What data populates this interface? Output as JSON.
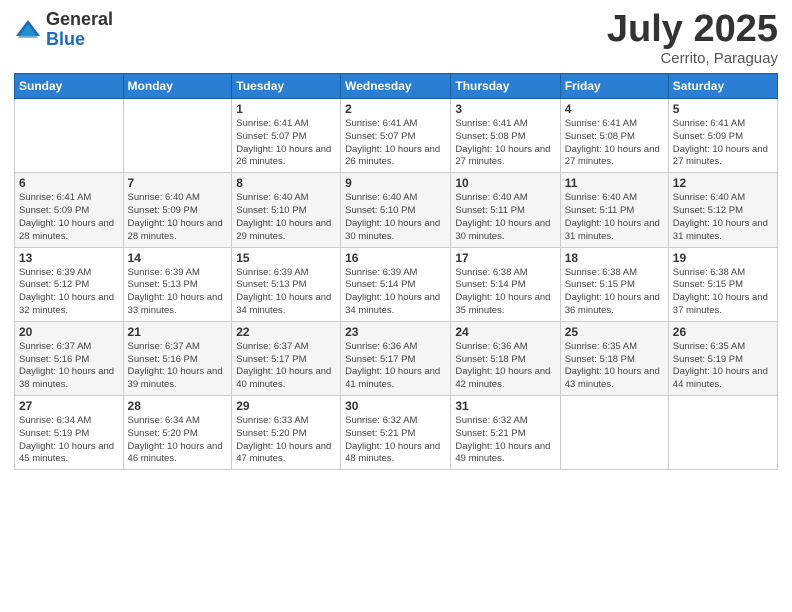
{
  "logo": {
    "general": "General",
    "blue": "Blue"
  },
  "title": {
    "month_year": "July 2025",
    "location": "Cerrito, Paraguay"
  },
  "weekdays": [
    "Sunday",
    "Monday",
    "Tuesday",
    "Wednesday",
    "Thursday",
    "Friday",
    "Saturday"
  ],
  "weeks": [
    [
      {
        "day": "",
        "info": ""
      },
      {
        "day": "",
        "info": ""
      },
      {
        "day": "1",
        "info": "Sunrise: 6:41 AM\nSunset: 5:07 PM\nDaylight: 10 hours and 26 minutes."
      },
      {
        "day": "2",
        "info": "Sunrise: 6:41 AM\nSunset: 5:07 PM\nDaylight: 10 hours and 26 minutes."
      },
      {
        "day": "3",
        "info": "Sunrise: 6:41 AM\nSunset: 5:08 PM\nDaylight: 10 hours and 27 minutes."
      },
      {
        "day": "4",
        "info": "Sunrise: 6:41 AM\nSunset: 5:08 PM\nDaylight: 10 hours and 27 minutes."
      },
      {
        "day": "5",
        "info": "Sunrise: 6:41 AM\nSunset: 5:09 PM\nDaylight: 10 hours and 27 minutes."
      }
    ],
    [
      {
        "day": "6",
        "info": "Sunrise: 6:41 AM\nSunset: 5:09 PM\nDaylight: 10 hours and 28 minutes."
      },
      {
        "day": "7",
        "info": "Sunrise: 6:40 AM\nSunset: 5:09 PM\nDaylight: 10 hours and 28 minutes."
      },
      {
        "day": "8",
        "info": "Sunrise: 6:40 AM\nSunset: 5:10 PM\nDaylight: 10 hours and 29 minutes."
      },
      {
        "day": "9",
        "info": "Sunrise: 6:40 AM\nSunset: 5:10 PM\nDaylight: 10 hours and 30 minutes."
      },
      {
        "day": "10",
        "info": "Sunrise: 6:40 AM\nSunset: 5:11 PM\nDaylight: 10 hours and 30 minutes."
      },
      {
        "day": "11",
        "info": "Sunrise: 6:40 AM\nSunset: 5:11 PM\nDaylight: 10 hours and 31 minutes."
      },
      {
        "day": "12",
        "info": "Sunrise: 6:40 AM\nSunset: 5:12 PM\nDaylight: 10 hours and 31 minutes."
      }
    ],
    [
      {
        "day": "13",
        "info": "Sunrise: 6:39 AM\nSunset: 5:12 PM\nDaylight: 10 hours and 32 minutes."
      },
      {
        "day": "14",
        "info": "Sunrise: 6:39 AM\nSunset: 5:13 PM\nDaylight: 10 hours and 33 minutes."
      },
      {
        "day": "15",
        "info": "Sunrise: 6:39 AM\nSunset: 5:13 PM\nDaylight: 10 hours and 34 minutes."
      },
      {
        "day": "16",
        "info": "Sunrise: 6:39 AM\nSunset: 5:14 PM\nDaylight: 10 hours and 34 minutes."
      },
      {
        "day": "17",
        "info": "Sunrise: 6:38 AM\nSunset: 5:14 PM\nDaylight: 10 hours and 35 minutes."
      },
      {
        "day": "18",
        "info": "Sunrise: 6:38 AM\nSunset: 5:15 PM\nDaylight: 10 hours and 36 minutes."
      },
      {
        "day": "19",
        "info": "Sunrise: 6:38 AM\nSunset: 5:15 PM\nDaylight: 10 hours and 37 minutes."
      }
    ],
    [
      {
        "day": "20",
        "info": "Sunrise: 6:37 AM\nSunset: 5:16 PM\nDaylight: 10 hours and 38 minutes."
      },
      {
        "day": "21",
        "info": "Sunrise: 6:37 AM\nSunset: 5:16 PM\nDaylight: 10 hours and 39 minutes."
      },
      {
        "day": "22",
        "info": "Sunrise: 6:37 AM\nSunset: 5:17 PM\nDaylight: 10 hours and 40 minutes."
      },
      {
        "day": "23",
        "info": "Sunrise: 6:36 AM\nSunset: 5:17 PM\nDaylight: 10 hours and 41 minutes."
      },
      {
        "day": "24",
        "info": "Sunrise: 6:36 AM\nSunset: 5:18 PM\nDaylight: 10 hours and 42 minutes."
      },
      {
        "day": "25",
        "info": "Sunrise: 6:35 AM\nSunset: 5:18 PM\nDaylight: 10 hours and 43 minutes."
      },
      {
        "day": "26",
        "info": "Sunrise: 6:35 AM\nSunset: 5:19 PM\nDaylight: 10 hours and 44 minutes."
      }
    ],
    [
      {
        "day": "27",
        "info": "Sunrise: 6:34 AM\nSunset: 5:19 PM\nDaylight: 10 hours and 45 minutes."
      },
      {
        "day": "28",
        "info": "Sunrise: 6:34 AM\nSunset: 5:20 PM\nDaylight: 10 hours and 46 minutes."
      },
      {
        "day": "29",
        "info": "Sunrise: 6:33 AM\nSunset: 5:20 PM\nDaylight: 10 hours and 47 minutes."
      },
      {
        "day": "30",
        "info": "Sunrise: 6:32 AM\nSunset: 5:21 PM\nDaylight: 10 hours and 48 minutes."
      },
      {
        "day": "31",
        "info": "Sunrise: 6:32 AM\nSunset: 5:21 PM\nDaylight: 10 hours and 49 minutes."
      },
      {
        "day": "",
        "info": ""
      },
      {
        "day": "",
        "info": ""
      }
    ]
  ]
}
